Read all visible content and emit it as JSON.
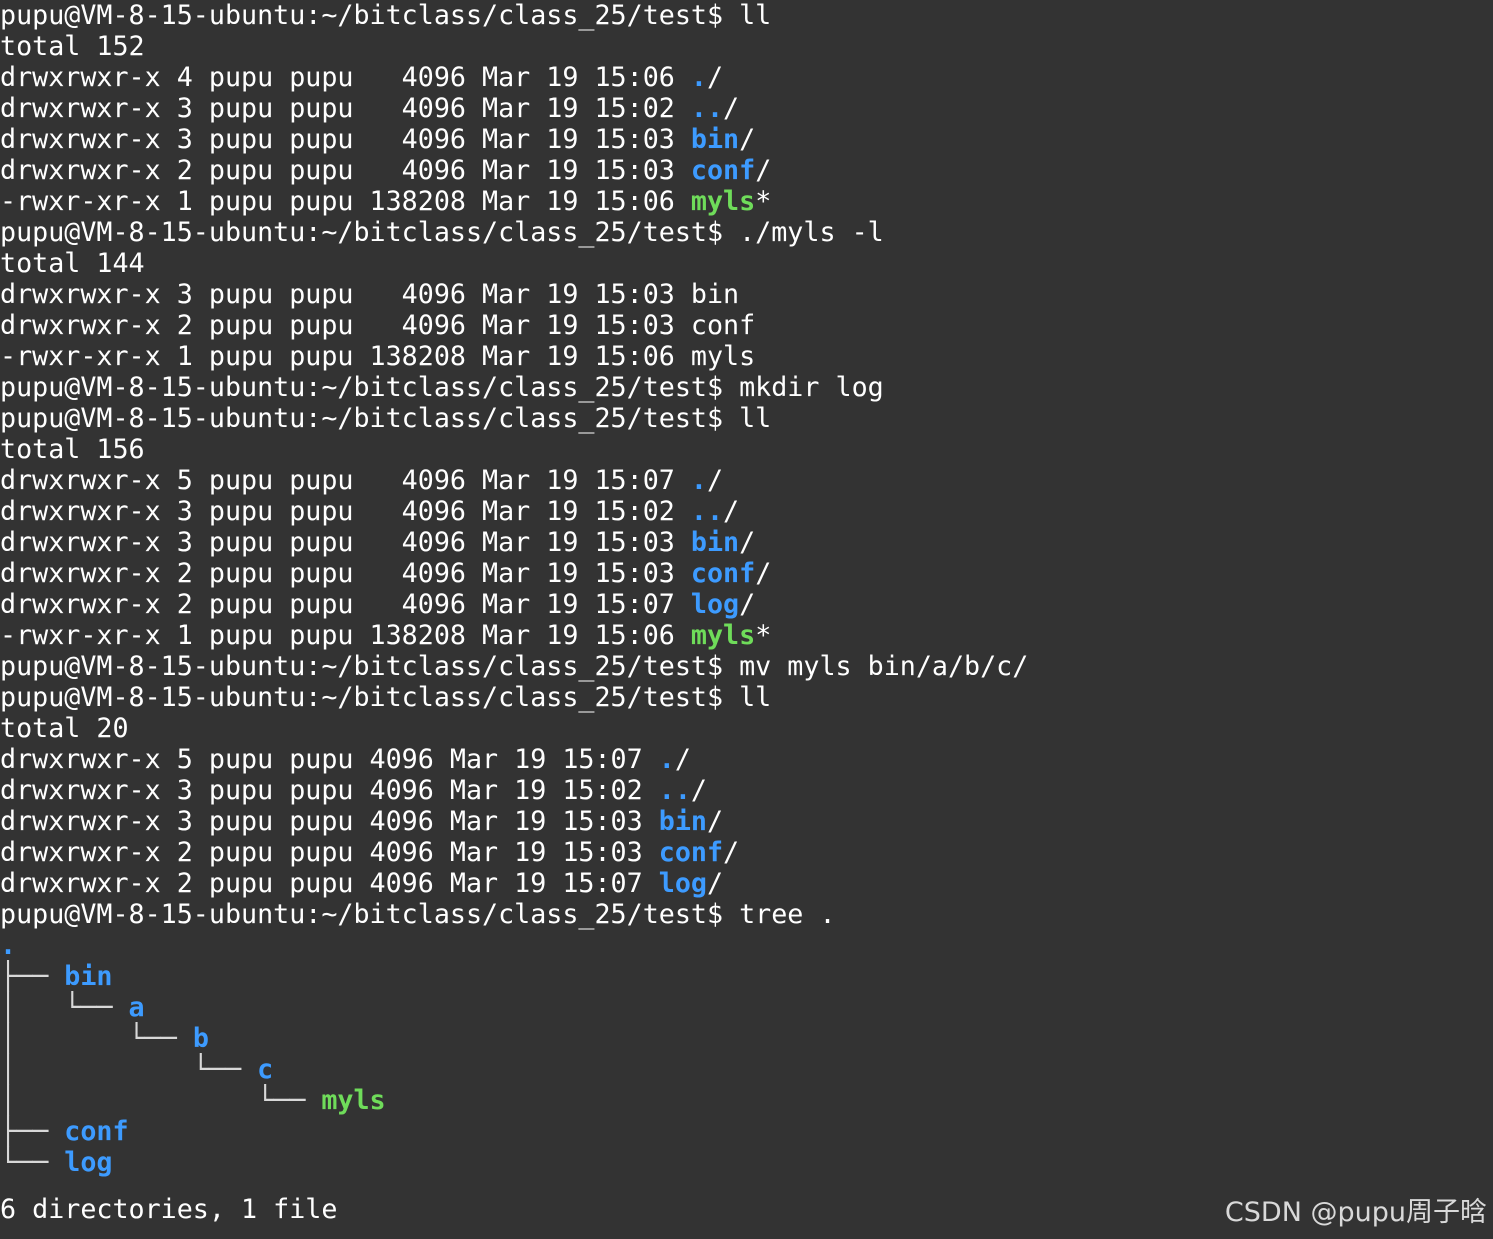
{
  "terminal": {
    "background": "#333333",
    "colors": {
      "text": "#ffffff",
      "directory": "#3d9bff",
      "executable": "#6fdc5a"
    },
    "lines": [
      {
        "type": "prompt",
        "prompt": "pupu@VM-8-15-ubuntu:~/bitclass/class_25/test$",
        "command": "ll"
      },
      {
        "type": "text",
        "text": "total 152"
      },
      {
        "type": "entry",
        "meta": "drwxrwxr-x 4 pupu pupu   4096 Mar 19 15:06 ",
        "name": ".",
        "kind": "dir",
        "suffix": "/"
      },
      {
        "type": "entry",
        "meta": "drwxrwxr-x 3 pupu pupu   4096 Mar 19 15:02 ",
        "name": "..",
        "kind": "dir",
        "suffix": "/"
      },
      {
        "type": "entry",
        "meta": "drwxrwxr-x 3 pupu pupu   4096 Mar 19 15:03 ",
        "name": "bin",
        "kind": "dir",
        "suffix": "/"
      },
      {
        "type": "entry",
        "meta": "drwxrwxr-x 2 pupu pupu   4096 Mar 19 15:03 ",
        "name": "conf",
        "kind": "dir",
        "suffix": "/"
      },
      {
        "type": "entry",
        "meta": "-rwxr-xr-x 1 pupu pupu 138208 Mar 19 15:06 ",
        "name": "myls",
        "kind": "exe",
        "suffix": "*"
      },
      {
        "type": "prompt",
        "prompt": "pupu@VM-8-15-ubuntu:~/bitclass/class_25/test$",
        "command": "./myls -l"
      },
      {
        "type": "text",
        "text": "total 144"
      },
      {
        "type": "text",
        "text": "drwxrwxr-x 3 pupu pupu   4096 Mar 19 15:03 bin"
      },
      {
        "type": "text",
        "text": "drwxrwxr-x 2 pupu pupu   4096 Mar 19 15:03 conf"
      },
      {
        "type": "text",
        "text": "-rwxr-xr-x 1 pupu pupu 138208 Mar 19 15:06 myls"
      },
      {
        "type": "prompt",
        "prompt": "pupu@VM-8-15-ubuntu:~/bitclass/class_25/test$",
        "command": "mkdir log"
      },
      {
        "type": "prompt",
        "prompt": "pupu@VM-8-15-ubuntu:~/bitclass/class_25/test$",
        "command": "ll"
      },
      {
        "type": "text",
        "text": "total 156"
      },
      {
        "type": "entry",
        "meta": "drwxrwxr-x 5 pupu pupu   4096 Mar 19 15:07 ",
        "name": ".",
        "kind": "dir",
        "suffix": "/"
      },
      {
        "type": "entry",
        "meta": "drwxrwxr-x 3 pupu pupu   4096 Mar 19 15:02 ",
        "name": "..",
        "kind": "dir",
        "suffix": "/"
      },
      {
        "type": "entry",
        "meta": "drwxrwxr-x 3 pupu pupu   4096 Mar 19 15:03 ",
        "name": "bin",
        "kind": "dir",
        "suffix": "/"
      },
      {
        "type": "entry",
        "meta": "drwxrwxr-x 2 pupu pupu   4096 Mar 19 15:03 ",
        "name": "conf",
        "kind": "dir",
        "suffix": "/"
      },
      {
        "type": "entry",
        "meta": "drwxrwxr-x 2 pupu pupu   4096 Mar 19 15:07 ",
        "name": "log",
        "kind": "dir",
        "suffix": "/"
      },
      {
        "type": "entry",
        "meta": "-rwxr-xr-x 1 pupu pupu 138208 Mar 19 15:06 ",
        "name": "myls",
        "kind": "exe",
        "suffix": "*"
      },
      {
        "type": "prompt",
        "prompt": "pupu@VM-8-15-ubuntu:~/bitclass/class_25/test$",
        "command": "mv myls bin/a/b/c/"
      },
      {
        "type": "prompt",
        "prompt": "pupu@VM-8-15-ubuntu:~/bitclass/class_25/test$",
        "command": "ll"
      },
      {
        "type": "text",
        "text": "total 20"
      },
      {
        "type": "entry",
        "meta": "drwxrwxr-x 5 pupu pupu 4096 Mar 19 15:07 ",
        "name": ".",
        "kind": "dir",
        "suffix": "/"
      },
      {
        "type": "entry",
        "meta": "drwxrwxr-x 3 pupu pupu 4096 Mar 19 15:02 ",
        "name": "..",
        "kind": "dir",
        "suffix": "/"
      },
      {
        "type": "entry",
        "meta": "drwxrwxr-x 3 pupu pupu 4096 Mar 19 15:03 ",
        "name": "bin",
        "kind": "dir",
        "suffix": "/"
      },
      {
        "type": "entry",
        "meta": "drwxrwxr-x 2 pupu pupu 4096 Mar 19 15:03 ",
        "name": "conf",
        "kind": "dir",
        "suffix": "/"
      },
      {
        "type": "entry",
        "meta": "drwxrwxr-x 2 pupu pupu 4096 Mar 19 15:07 ",
        "name": "log",
        "kind": "dir",
        "suffix": "/"
      },
      {
        "type": "prompt",
        "prompt": "pupu@VM-8-15-ubuntu:~/bitclass/class_25/test$",
        "command": "tree ."
      },
      {
        "type": "tree",
        "prefix": "",
        "name": ".",
        "kind": "dir"
      },
      {
        "type": "tree",
        "prefix": "├── ",
        "name": "bin",
        "kind": "dir"
      },
      {
        "type": "tree",
        "prefix": "│   └── ",
        "name": "a",
        "kind": "dir"
      },
      {
        "type": "tree",
        "prefix": "│       └── ",
        "name": "b",
        "kind": "dir"
      },
      {
        "type": "tree",
        "prefix": "│           └── ",
        "name": "c",
        "kind": "dir"
      },
      {
        "type": "tree",
        "prefix": "│               └── ",
        "name": "myls",
        "kind": "exe"
      },
      {
        "type": "tree",
        "prefix": "├── ",
        "name": "conf",
        "kind": "dir"
      },
      {
        "type": "tree",
        "prefix": "└── ",
        "name": "log",
        "kind": "dir"
      },
      {
        "type": "blank"
      },
      {
        "type": "text",
        "text": "6 directories, 1 file"
      }
    ]
  },
  "watermark": {
    "text": "CSDN @pupu周子晗"
  }
}
